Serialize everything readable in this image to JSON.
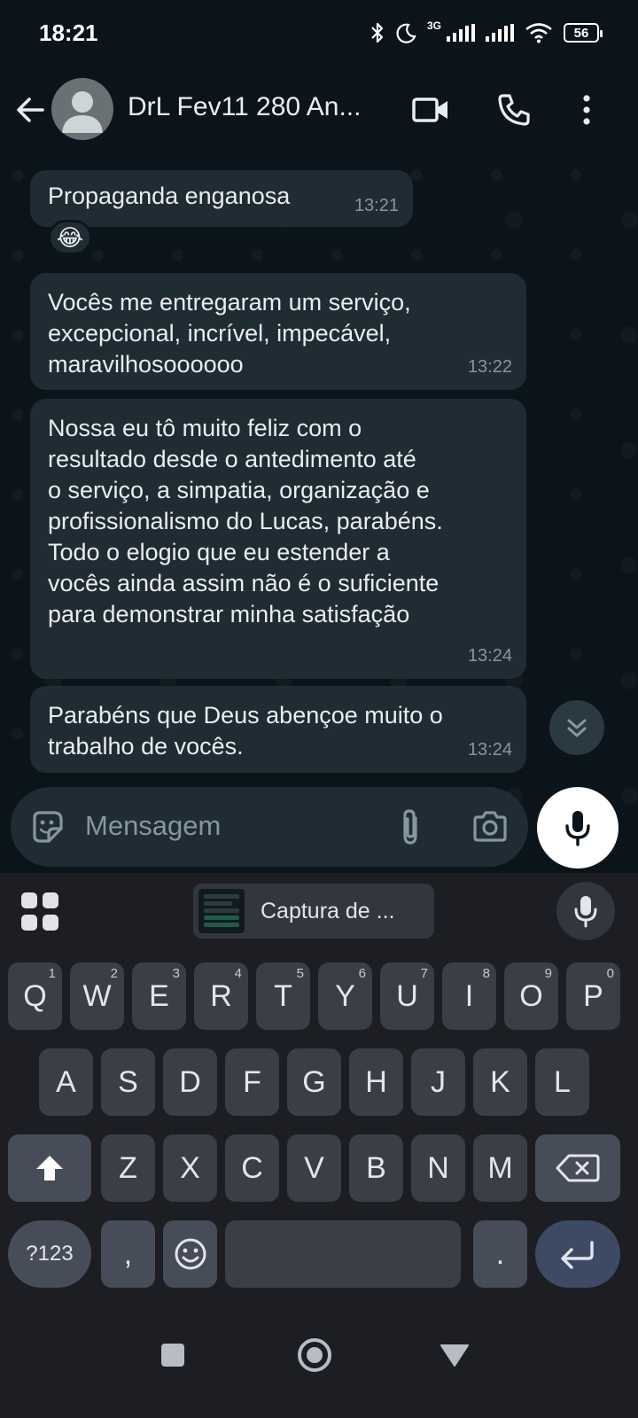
{
  "status_bar": {
    "time": "18:21",
    "network_label": "3G",
    "battery": "56",
    "icons": [
      "bluetooth-icon",
      "moon-icon",
      "signal-icon",
      "signal-icon",
      "wifi-icon",
      "battery-icon"
    ]
  },
  "header": {
    "contact_name": "DrL Fev11 280 An...",
    "icons": [
      "back-arrow-icon",
      "avatar",
      "video-call-icon",
      "phone-icon",
      "more-vert-icon"
    ]
  },
  "messages": [
    {
      "text": "Propaganda enganosa",
      "time": "13:21",
      "reaction": "😂"
    },
    {
      "text": "Vocês me entregaram um serviço,\nexcepcional, incrível, impecável,\nmaravilhosoooooo",
      "time": "13:22"
    },
    {
      "text": "Nossa eu tô muito feliz com o\nresultado desde o antedimento até\no serviço, a simpatia, organização e\nprofissionalismo do Lucas, parabéns.\nTodo o elogio que eu estender a\nvocês ainda assim não é o suficiente\npara demonstrar minha satisfação",
      "time": "13:24"
    },
    {
      "text": "Parabéns que Deus abençoe muito o\ntrabalho de vocês.",
      "time": "13:24"
    }
  ],
  "composer": {
    "placeholder": "Mensagem",
    "icons": [
      "sticker-icon",
      "attach-icon",
      "camera-icon",
      "mic-icon"
    ]
  },
  "keyboard": {
    "clipboard_label": "Captura de ...",
    "row1": [
      "Q",
      "W",
      "E",
      "R",
      "T",
      "Y",
      "U",
      "I",
      "O",
      "P"
    ],
    "row1_hints": [
      "1",
      "2",
      "3",
      "4",
      "5",
      "6",
      "7",
      "8",
      "9",
      "0"
    ],
    "row2": [
      "A",
      "S",
      "D",
      "F",
      "G",
      "H",
      "J",
      "K",
      "L"
    ],
    "row3": [
      "Z",
      "X",
      "C",
      "V",
      "B",
      "N",
      "M"
    ],
    "symbols_label": "?123",
    "comma": ",",
    "period": ".",
    "accent_color": "#3e4a63"
  },
  "colors": {
    "background": "#0b141a",
    "bubble": "#202c33",
    "timestamp": "#8696a0",
    "keyboard_bg": "#1c1e24"
  },
  "navbar": {
    "icons": [
      "recents-icon",
      "home-icon",
      "back-triangle-icon"
    ]
  }
}
